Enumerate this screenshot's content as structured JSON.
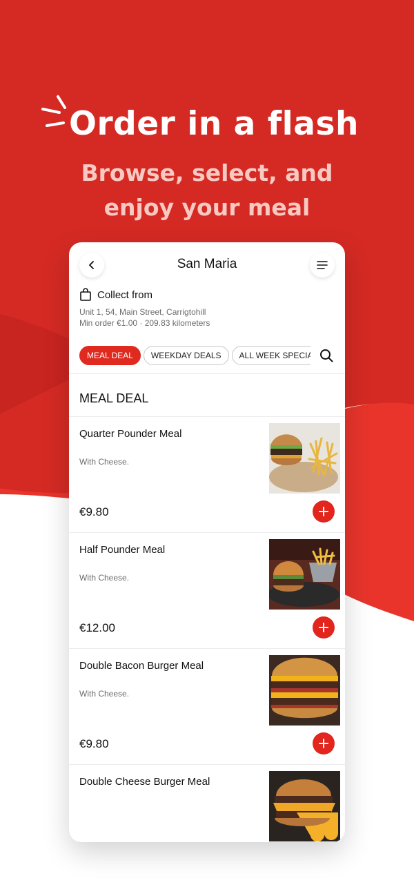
{
  "colors": {
    "brand_red": "#d52a24",
    "accent_red": "#e2261e",
    "dark_red": "#b81e1b"
  },
  "hero": {
    "title": "Order in a flash",
    "subtitle_line1": "Browse, select, and",
    "subtitle_line2": "enjoy your meal"
  },
  "header": {
    "store_name": "San Maria",
    "back_icon": "chevron-left-icon",
    "menu_icon": "menu-lines-icon"
  },
  "collect": {
    "label": "Collect from",
    "icon": "shopping-bag-icon",
    "address": "Unit 1, 54, Main Street, Carrigtohill",
    "min_order": "Min order €1.00 · 209.83 kilometers"
  },
  "tabs": [
    {
      "label": "MEAL DEAL",
      "active": true
    },
    {
      "label": "WEEKDAY DEALS",
      "active": false
    },
    {
      "label": "ALL WEEK SPECIA",
      "active": false
    }
  ],
  "section_title": "MEAL DEAL",
  "items": [
    {
      "name": "Quarter Pounder Meal",
      "desc": "With Cheese.",
      "price": "€9.80"
    },
    {
      "name": "Half Pounder Meal",
      "desc": "With Cheese.",
      "price": "€12.00"
    },
    {
      "name": "Double Bacon Burger Meal",
      "desc": "With Cheese.",
      "price": "€9.80"
    },
    {
      "name": "Double Cheese Burger Meal",
      "desc": "",
      "price": ""
    }
  ]
}
